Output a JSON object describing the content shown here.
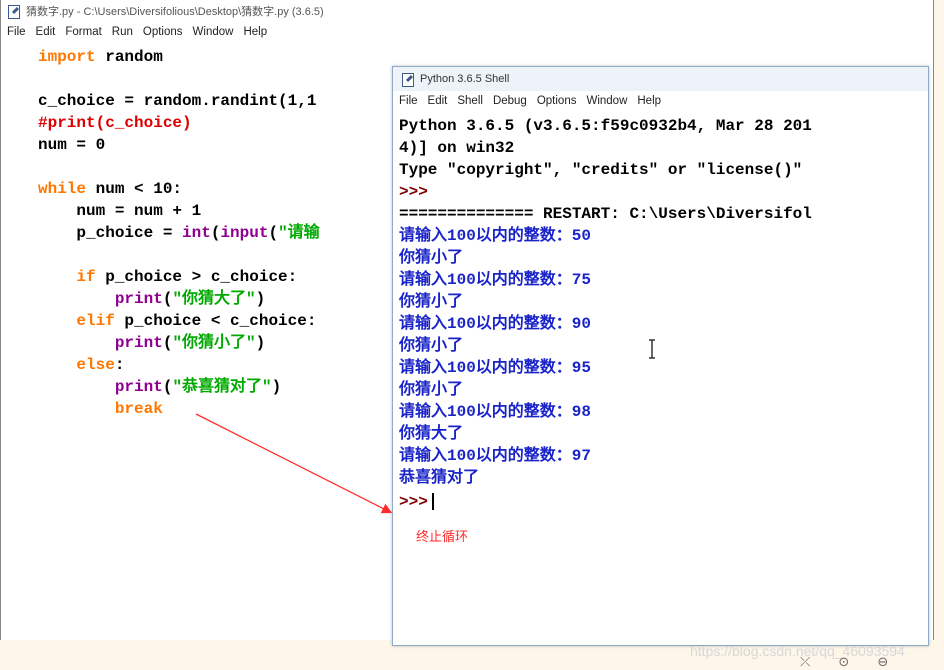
{
  "editor": {
    "title": "猜数字.py - C:\\Users\\Diversifolious\\Desktop\\猜数字.py (3.6.5)",
    "menu": [
      "File",
      "Edit",
      "Format",
      "Run",
      "Options",
      "Window",
      "Help"
    ],
    "code": {
      "l1_kw": "import",
      "l1_rest": " random",
      "l2": "c_choice = random.randint(1,1",
      "l3": "#print(c_choice)",
      "l4": "num = 0",
      "l5_kw": "while",
      "l5_rest": " num < 10:",
      "l6": "    num = num + 1",
      "l7_a": "    p_choice = ",
      "l7_b1": "int",
      "l7_c": "(",
      "l7_b2": "input",
      "l7_d": "(",
      "l7_str": "\"请输",
      "l8_kw": "    if",
      "l8_rest": " p_choice > c_choice:",
      "l9_bi": "        print",
      "l9_a": "(",
      "l9_str": "\"你猜大了\"",
      "l9_b": ")",
      "l10_kw": "    elif",
      "l10_rest": " p_choice < c_choice:",
      "l11_bi": "        print",
      "l11_a": "(",
      "l11_str": "\"你猜小了\"",
      "l11_b": ")",
      "l12_kw": "    else",
      "l12_rest": ":",
      "l13_bi": "        print",
      "l13_a": "(",
      "l13_str": "\"恭喜猜对了\"",
      "l13_b": ")",
      "l14_kw": "        break"
    }
  },
  "shell": {
    "title": "Python 3.6.5 Shell",
    "menu": [
      "File",
      "Edit",
      "Shell",
      "Debug",
      "Options",
      "Window",
      "Help"
    ],
    "lines": {
      "banner1": "Python 3.6.5 (v3.6.5:f59c0932b4, Mar 28 201",
      "banner2": "4)] on win32",
      "banner3": "Type \"copyright\", \"credits\" or \"license()\"",
      "prompt1": ">>>",
      "restart": "============== RESTART: C:\\Users\\Diversifol",
      "q1": "请输入100以内的整数：50",
      "r1": "你猜小了",
      "q2": "请输入100以内的整数：75",
      "r2": "你猜小了",
      "q3": "请输入100以内的整数：90",
      "r3": "你猜小了",
      "q4": "请输入100以内的整数：95",
      "r4": "你猜小了",
      "q5": "请输入100以内的整数：98",
      "r5": "你猜大了",
      "q6": "请输入100以内的整数：97",
      "r6": "恭喜猜对了",
      "prompt2": ">>>"
    }
  },
  "annotation": {
    "text": "终止循环",
    "color": "#ff2a2a"
  },
  "watermark": "https://blog.csdn.net/qq_46093594",
  "colors": {
    "keyword": "#ff7700",
    "builtin": "#900090",
    "string": "#00aa00",
    "comment": "#dd0000",
    "prompt": "#7f0000",
    "user_output": "#1b24c8"
  }
}
